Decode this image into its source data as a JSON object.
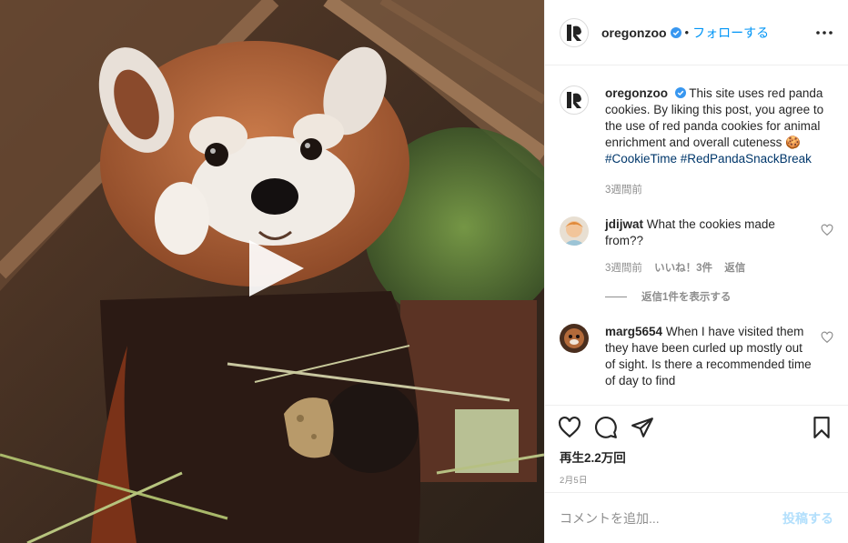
{
  "post": {
    "username": "oregonzoo",
    "separator": "•",
    "follow_label": "フォローする",
    "more_icon": "more-horizontal-icon"
  },
  "caption": {
    "username": "oregonzoo",
    "text_before_emoji": "This site uses red panda cookies. By liking this post, you agree to the use of red panda cookies for animal enrichment and overall cuteness",
    "emoji": "🍪",
    "hashtags": "#CookieTime #RedPandaSnackBreak",
    "time": "3週間前"
  },
  "comments": [
    {
      "username": "jdijwat",
      "text": "What the cookies made from??",
      "time": "3週間前",
      "likes": "いいね！3件",
      "reply": "返信",
      "view_replies": "返信1件を表示する"
    },
    {
      "username": "marg5654",
      "text": "When I have visited them they have been curled up mostly out of sight. Is there a recommended time of day to find"
    }
  ],
  "actions": {
    "views": "再生2.2万回",
    "date": "2月5日"
  },
  "composer": {
    "placeholder": "コメントを追加...",
    "post_label": "投稿する"
  },
  "colors": {
    "accent": "#0095f6",
    "post_disabled": "#b2dffc",
    "text": "#262626",
    "muted": "#8e8e8e"
  }
}
